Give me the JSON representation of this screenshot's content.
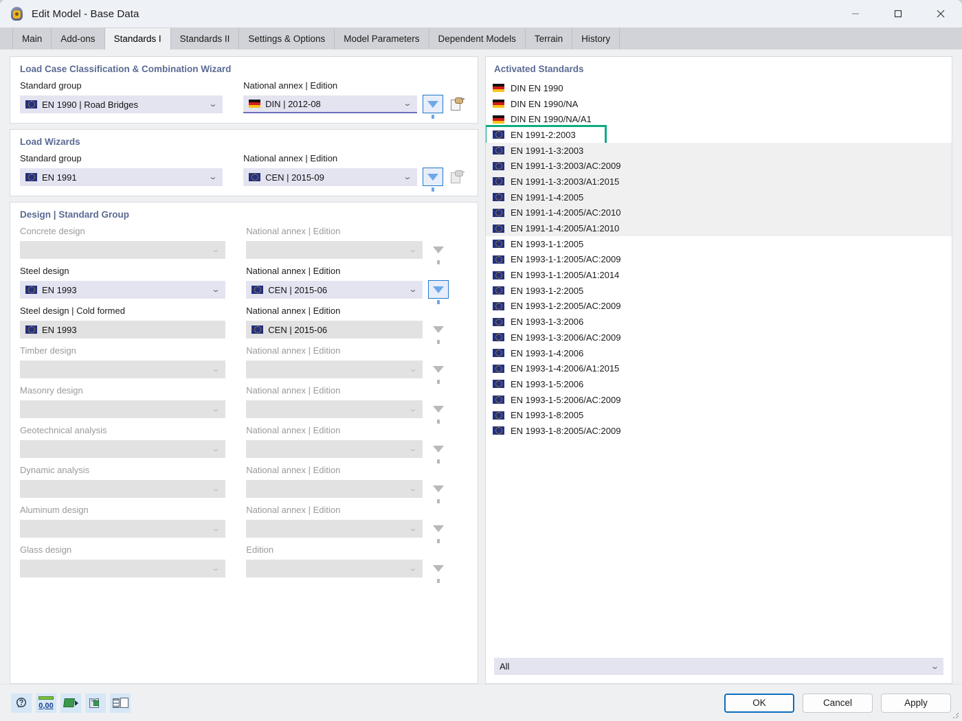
{
  "window": {
    "title": "Edit Model - Base Data",
    "minimize": "—",
    "maximize": "□",
    "close": "✕"
  },
  "tabs": [
    {
      "label": "Main",
      "active": false
    },
    {
      "label": "Add-ons",
      "active": false
    },
    {
      "label": "Standards I",
      "active": true
    },
    {
      "label": "Standards II",
      "active": false
    },
    {
      "label": "Settings & Options",
      "active": false
    },
    {
      "label": "Model Parameters",
      "active": false
    },
    {
      "label": "Dependent Models",
      "active": false
    },
    {
      "label": "Terrain",
      "active": false
    },
    {
      "label": "History",
      "active": false
    }
  ],
  "sections": {
    "load_case": {
      "title": "Load Case Classification & Combination Wizard",
      "standard_group_label": "Standard group",
      "standard_group_value": "EN 1990 | Road Bridges",
      "standard_group_flag": "eu-flag-icon",
      "annex_label": "National annex | Edition",
      "annex_value": "DIN | 2012-08",
      "annex_flag": "german-flag-icon"
    },
    "load_wizards": {
      "title": "Load Wizards",
      "standard_group_label": "Standard group",
      "standard_group_value": "EN 1991",
      "standard_group_flag": "eu-flag-icon",
      "annex_label": "National annex | Edition",
      "annex_value": "CEN | 2015-09",
      "annex_flag": "eu-flag-icon"
    },
    "design": {
      "title": "Design | Standard Group",
      "rows": [
        {
          "label": "Concrete design",
          "value": "",
          "annex_label": "National annex | Edition",
          "annex_value": "",
          "enabled": false,
          "flag": "",
          "annex_flag": "",
          "filter_active": false,
          "readonly": false
        },
        {
          "label": "Steel design",
          "value": "EN 1993",
          "annex_label": "National annex | Edition",
          "annex_value": "CEN | 2015-06",
          "enabled": true,
          "flag": "eu-flag-icon",
          "annex_flag": "eu-flag-icon",
          "filter_active": true,
          "readonly": false
        },
        {
          "label": "Steel design | Cold formed",
          "value": "EN 1993",
          "annex_label": "National annex | Edition",
          "annex_value": "CEN | 2015-06",
          "enabled": true,
          "flag": "eu-flag-icon",
          "annex_flag": "eu-flag-icon",
          "filter_active": false,
          "readonly": true
        },
        {
          "label": "Timber design",
          "value": "",
          "annex_label": "National annex | Edition",
          "annex_value": "",
          "enabled": false,
          "flag": "",
          "annex_flag": "",
          "filter_active": false,
          "readonly": false
        },
        {
          "label": "Masonry design",
          "value": "",
          "annex_label": "National annex | Edition",
          "annex_value": "",
          "enabled": false,
          "flag": "",
          "annex_flag": "",
          "filter_active": false,
          "readonly": false
        },
        {
          "label": "Geotechnical analysis",
          "value": "",
          "annex_label": "National annex | Edition",
          "annex_value": "",
          "enabled": false,
          "flag": "",
          "annex_flag": "",
          "filter_active": false,
          "readonly": false
        },
        {
          "label": "Dynamic analysis",
          "value": "",
          "annex_label": "National annex | Edition",
          "annex_value": "",
          "enabled": false,
          "flag": "",
          "annex_flag": "",
          "filter_active": false,
          "readonly": false
        },
        {
          "label": "Aluminum design",
          "value": "",
          "annex_label": "National annex | Edition",
          "annex_value": "",
          "enabled": false,
          "flag": "",
          "annex_flag": "",
          "filter_active": false,
          "readonly": false
        },
        {
          "label": "Glass design",
          "value": "",
          "annex_label": "Edition",
          "annex_value": "",
          "enabled": false,
          "flag": "",
          "annex_flag": "",
          "filter_active": false,
          "readonly": false
        }
      ]
    }
  },
  "activated_standards": {
    "title": "Activated Standards",
    "items": [
      {
        "label": "DIN EN 1990",
        "flag": "german-flag-icon",
        "group_selected": false,
        "focused": false
      },
      {
        "label": "DIN EN 1990/NA",
        "flag": "german-flag-icon",
        "group_selected": false,
        "focused": false
      },
      {
        "label": "DIN EN 1990/NA/A1",
        "flag": "german-flag-icon",
        "group_selected": false,
        "focused": false
      },
      {
        "label": "EN 1991-2:2003",
        "flag": "eu-flag-icon",
        "group_selected": false,
        "focused": true
      },
      {
        "label": "EN 1991-1-3:2003",
        "flag": "eu-flag-icon",
        "group_selected": true,
        "focused": false
      },
      {
        "label": "EN 1991-1-3:2003/AC:2009",
        "flag": "eu-flag-icon",
        "group_selected": true,
        "focused": false
      },
      {
        "label": "EN 1991-1-3:2003/A1:2015",
        "flag": "eu-flag-icon",
        "group_selected": true,
        "focused": false
      },
      {
        "label": "EN 1991-1-4:2005",
        "flag": "eu-flag-icon",
        "group_selected": true,
        "focused": false
      },
      {
        "label": "EN 1991-1-4:2005/AC:2010",
        "flag": "eu-flag-icon",
        "group_selected": true,
        "focused": false
      },
      {
        "label": "EN 1991-1-4:2005/A1:2010",
        "flag": "eu-flag-icon",
        "group_selected": true,
        "focused": false
      },
      {
        "label": "EN 1993-1-1:2005",
        "flag": "eu-flag-icon",
        "group_selected": false,
        "focused": false
      },
      {
        "label": "EN 1993-1-1:2005/AC:2009",
        "flag": "eu-flag-icon",
        "group_selected": false,
        "focused": false
      },
      {
        "label": "EN 1993-1-1:2005/A1:2014",
        "flag": "eu-flag-icon",
        "group_selected": false,
        "focused": false
      },
      {
        "label": "EN 1993-1-2:2005",
        "flag": "eu-flag-icon",
        "group_selected": false,
        "focused": false
      },
      {
        "label": "EN 1993-1-2:2005/AC:2009",
        "flag": "eu-flag-icon",
        "group_selected": false,
        "focused": false
      },
      {
        "label": "EN 1993-1-3:2006",
        "flag": "eu-flag-icon",
        "group_selected": false,
        "focused": false
      },
      {
        "label": "EN 1993-1-3:2006/AC:2009",
        "flag": "eu-flag-icon",
        "group_selected": false,
        "focused": false
      },
      {
        "label": "EN 1993-1-4:2006",
        "flag": "eu-flag-icon",
        "group_selected": false,
        "focused": false
      },
      {
        "label": "EN 1993-1-4:2006/A1:2015",
        "flag": "eu-flag-icon",
        "group_selected": false,
        "focused": false
      },
      {
        "label": "EN 1993-1-5:2006",
        "flag": "eu-flag-icon",
        "group_selected": false,
        "focused": false
      },
      {
        "label": "EN 1993-1-5:2006/AC:2009",
        "flag": "eu-flag-icon",
        "group_selected": false,
        "focused": false
      },
      {
        "label": "EN 1993-1-8:2005",
        "flag": "eu-flag-icon",
        "group_selected": false,
        "focused": false
      },
      {
        "label": "EN 1993-1-8:2005/AC:2009",
        "flag": "eu-flag-icon",
        "group_selected": false,
        "focused": false
      }
    ],
    "filter_value": "All"
  },
  "footer": {
    "tools": [
      {
        "name": "help-icon",
        "title": "Help"
      },
      {
        "name": "units-icon",
        "title": "Units and decimal places"
      },
      {
        "name": "export-icon",
        "title": "Export"
      },
      {
        "name": "save-as-icon",
        "title": "Save as default"
      },
      {
        "name": "library-icon",
        "title": "Library"
      }
    ],
    "ok": "OK",
    "cancel": "Cancel",
    "apply": "Apply"
  },
  "colors": {
    "accent_highlight": "#0bab82",
    "section_title": "#5a6a93",
    "field_bg": "#e4e4f1",
    "focus_blue": "#0d6dbd"
  }
}
